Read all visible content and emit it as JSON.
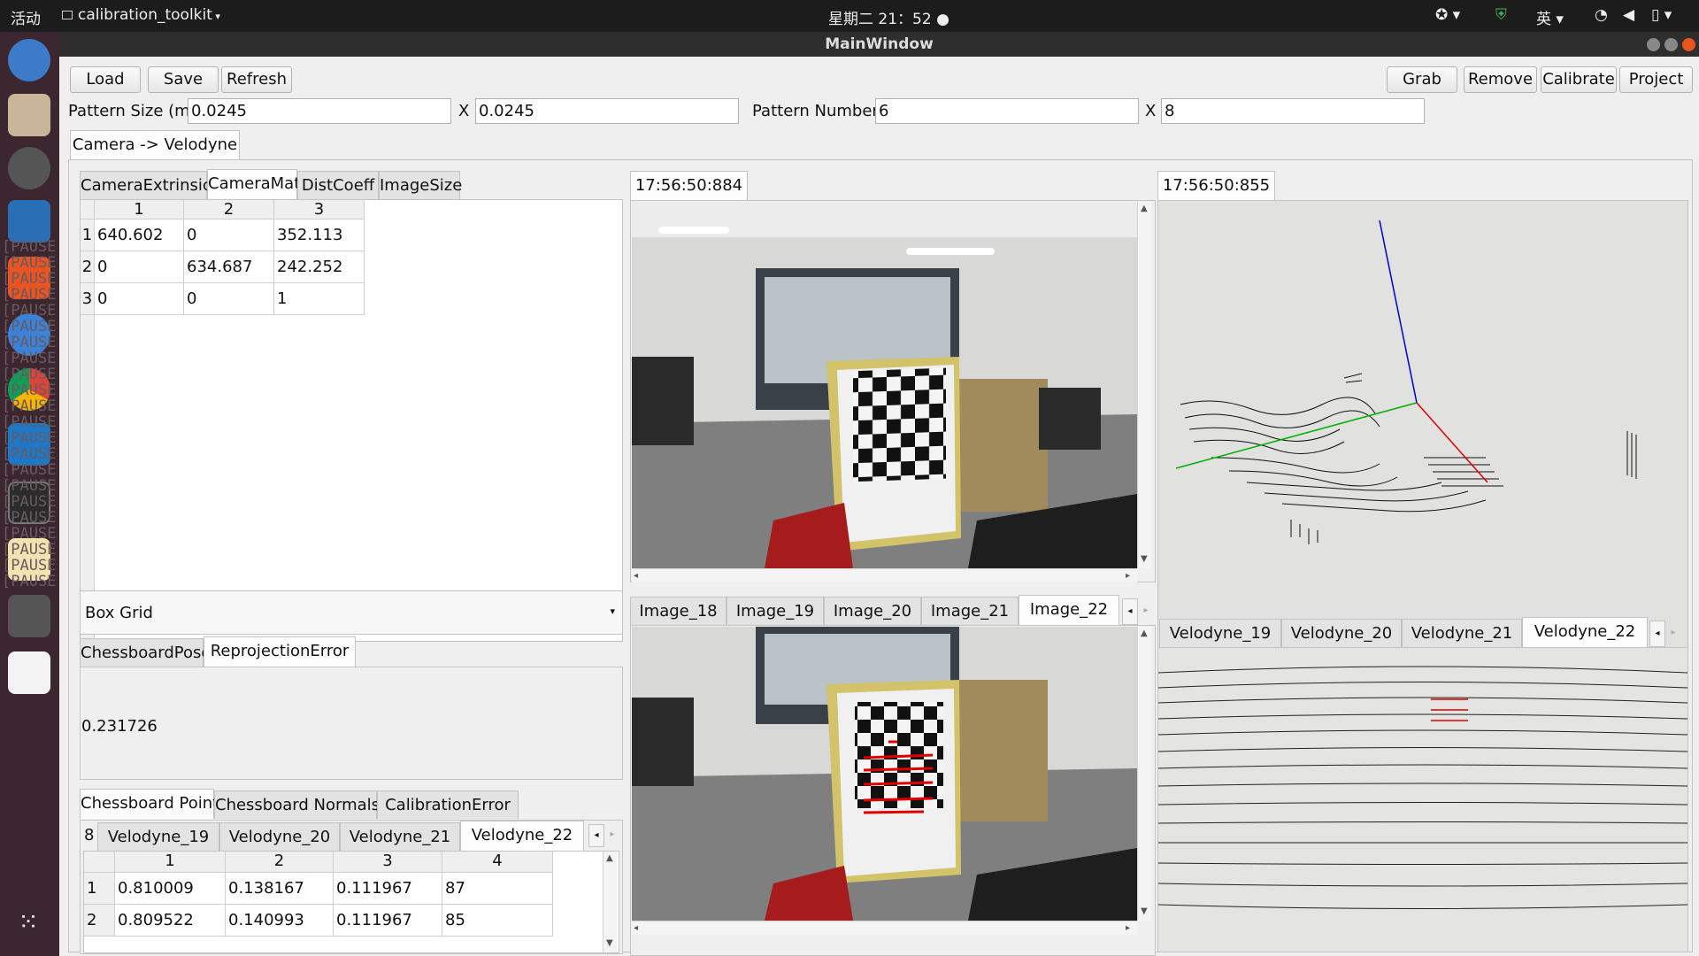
{
  "topbar": {
    "activities": "活动",
    "app_menu": "calibration_toolkit",
    "clock": "星期二 21：52",
    "input_method": "英"
  },
  "dock": {
    "pause_labels": [
      "[PAUSE",
      "[PAUSE",
      "[PAUSE",
      "[PAUSE",
      "[PAUSE",
      "[PAUSE",
      "[PAUSE",
      "[PAUSE",
      "[PAUSE",
      "[PAUSE",
      "[PAUSE",
      "[PAUSE",
      "[PAUSE",
      "[PAUSE",
      "[PAUSE",
      "[PAUSE",
      "[PAUSE",
      "[PAUSE",
      "[PAUSE",
      "[PAUSE",
      "[PAUSE",
      "[PAUSE"
    ]
  },
  "window": {
    "title": "MainWindow"
  },
  "toolbar": {
    "load": "Load",
    "save": "Save",
    "refresh": "Refresh",
    "grab": "Grab",
    "remove": "Remove",
    "calibrate": "Calibrate",
    "project": "Project"
  },
  "pattern": {
    "size_label": "Pattern Size (m)",
    "size_x": "0.0245",
    "x_sep": "X",
    "size_y": "0.0245",
    "number_label": "Pattern Number",
    "number_x": "6",
    "x_sep2": "X",
    "number_y": "8"
  },
  "main_tab": "Camera -> Velodyne",
  "mat_tabs": [
    "CameraExtrinsicMat",
    "CameraMat",
    "DistCoeff",
    "ImageSize"
  ],
  "camera_mat": {
    "col_headers": [
      "1",
      "2",
      "3"
    ],
    "row_headers": [
      "1",
      "2",
      "3"
    ],
    "rows": [
      [
        "640.602",
        "0",
        "352.113"
      ],
      [
        "0",
        "634.687",
        "242.252"
      ],
      [
        "0",
        "0",
        "1"
      ]
    ]
  },
  "box_grid": {
    "selected": "Box Grid"
  },
  "pose_tabs": [
    "ChessboardPose",
    "ReprojectionError"
  ],
  "reprojection_error": "0.231726",
  "points_tabs": [
    "Chessboard Points",
    "Chessboard Normals",
    "CalibrationError"
  ],
  "velodyne_sub": {
    "count": "8",
    "tabs": [
      "Velodyne_19",
      "Velodyne_20",
      "Velodyne_21",
      "Velodyne_22"
    ]
  },
  "points_table": {
    "col_headers": [
      "1",
      "2",
      "3",
      "4"
    ],
    "row_headers": [
      "1",
      "2"
    ],
    "rows": [
      [
        "0.810009",
        "0.138167",
        "0.111967",
        "87"
      ],
      [
        "0.809522",
        "0.140993",
        "0.111967",
        "85"
      ]
    ]
  },
  "image_view": {
    "timestamp": "17:56:50:884"
  },
  "image_tabs": [
    "Image_18",
    "Image_19",
    "Image_20",
    "Image_21",
    "Image_22"
  ],
  "velodyne_view": {
    "timestamp": "17:56:50:855"
  },
  "velodyne_tabs": [
    "Velodyne_19",
    "Velodyne_20",
    "Velodyne_21",
    "Velodyne_22"
  ],
  "colors": {
    "accent_orange": "#e95420",
    "dock_bg": "#3c2730",
    "axis_x": "#e00000",
    "axis_y": "#00b000",
    "axis_z": "#0000d0"
  }
}
